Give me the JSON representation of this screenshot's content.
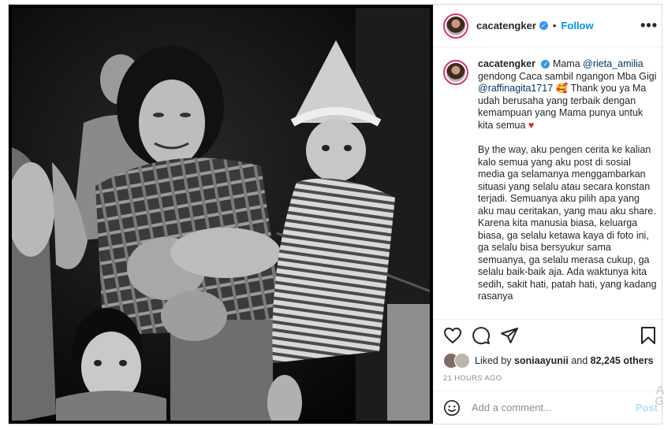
{
  "post": {
    "username": "cacatengker",
    "follow_label": "Follow",
    "more_label": "•••",
    "verified_mark": "✓"
  },
  "caption": {
    "username": "cacatengker",
    "t1": "Mama",
    "m1": "@rieta_amilia",
    "t2": "gendong Caca sambil ngangon Mba Gigi",
    "m2": "@raffinagita1717",
    "e1": "🥰",
    "t3": "Thank you ya Ma udah berusaha yang terbaik dengan kemampuan yang Mama punya untuk kita semua",
    "e2": "♥",
    "p2": "By the way, aku pengen cerita ke kalian kalo semua yang aku post di sosial media ga selamanya menggambarkan situasi yang selalu atau secara konstan terjadi. Semuanya aku pilih apa yang aku mau ceritakan, yang mau aku share. Karena kita manusia biasa, keluarga biasa, ga selalu ketawa kaya di foto ini, ga selalu bisa bersyukur sama semuanya, ga selalu merasa cukup, ga selalu baik-baik aja. Ada waktunya kita sedih, sakit hati, patah hati, yang kadang rasanya"
  },
  "likes": {
    "prefix": "Liked by",
    "user": "soniaayunii",
    "middle": "and",
    "count": "82,245 others"
  },
  "timestamp": "21 HOURS AGO",
  "comment_box": {
    "placeholder": "Add a comment...",
    "post_label": "Post",
    "watermark": "A\nG"
  },
  "icons": {
    "like": "heart-icon",
    "comment": "comment-icon",
    "share": "share-icon",
    "save": "bookmark-icon",
    "emoji": "smile-icon"
  }
}
